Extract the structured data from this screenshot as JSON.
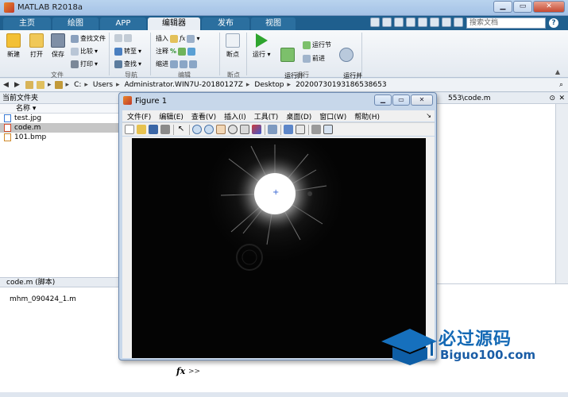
{
  "window": {
    "title": "MATLAB R2018a"
  },
  "tabs": [
    "主页",
    "绘图",
    "APP",
    "编辑器",
    "发布",
    "视图"
  ],
  "search": {
    "placeholder": "搜索文档"
  },
  "ribbon": {
    "file": {
      "section": "文件",
      "new": "新建",
      "open": "打开",
      "save": "保存",
      "find_files": "查找文件",
      "compare": "比较",
      "print": "打印"
    },
    "nav": {
      "section": "导航",
      "goto": "转至",
      "find": "查找"
    },
    "edit": {
      "section": "编辑",
      "insert": "插入",
      "fx": "fx",
      "comment": "注释",
      "indent": "缩进"
    },
    "breakpoint": {
      "section": "断点",
      "label": "断点"
    },
    "run": {
      "section": "运行",
      "run": "运行",
      "run_advance": "运行并\n前进",
      "run_section": "运行节",
      "advance": "前进",
      "run_time": "运行并\n计时"
    }
  },
  "address": [
    "C:",
    "Users",
    "Administrator.WIN7U-20180127Z",
    "Desktop",
    "20200730193186538653"
  ],
  "current_folder": {
    "header": "当前文件夹",
    "column": "名称 ▾",
    "files": [
      {
        "name": "test.jpg",
        "selected": false,
        "icon_color": "#3a7bd5"
      },
      {
        "name": "code.m",
        "selected": true,
        "icon_color": "#d04a2a"
      },
      {
        "name": "101.bmp",
        "selected": false,
        "icon_color": "#d08a2a"
      }
    ]
  },
  "editor": {
    "tab_path": "553\\code.m"
  },
  "details": {
    "header": "code.m  (脚本)",
    "item": "mhm_090424_1.m"
  },
  "command": {
    "fx": "fx",
    "prompt": ">>"
  },
  "figure": {
    "title": "Figure 1",
    "menus": [
      "文件(F)",
      "编辑(E)",
      "查看(V)",
      "插入(I)",
      "工具(T)",
      "桌面(D)",
      "窗口(W)",
      "帮助(H)"
    ],
    "marker": "+"
  },
  "watermark": {
    "cn": "必过源码",
    "en": "Biguo100.com"
  },
  "colors": {
    "ribbon_tab_bg": "#1f5f8e",
    "active_tab": "#e9eef4",
    "plot_bg": "#040404",
    "marker": "#2f5fd0",
    "watermark": "#1469b5"
  }
}
